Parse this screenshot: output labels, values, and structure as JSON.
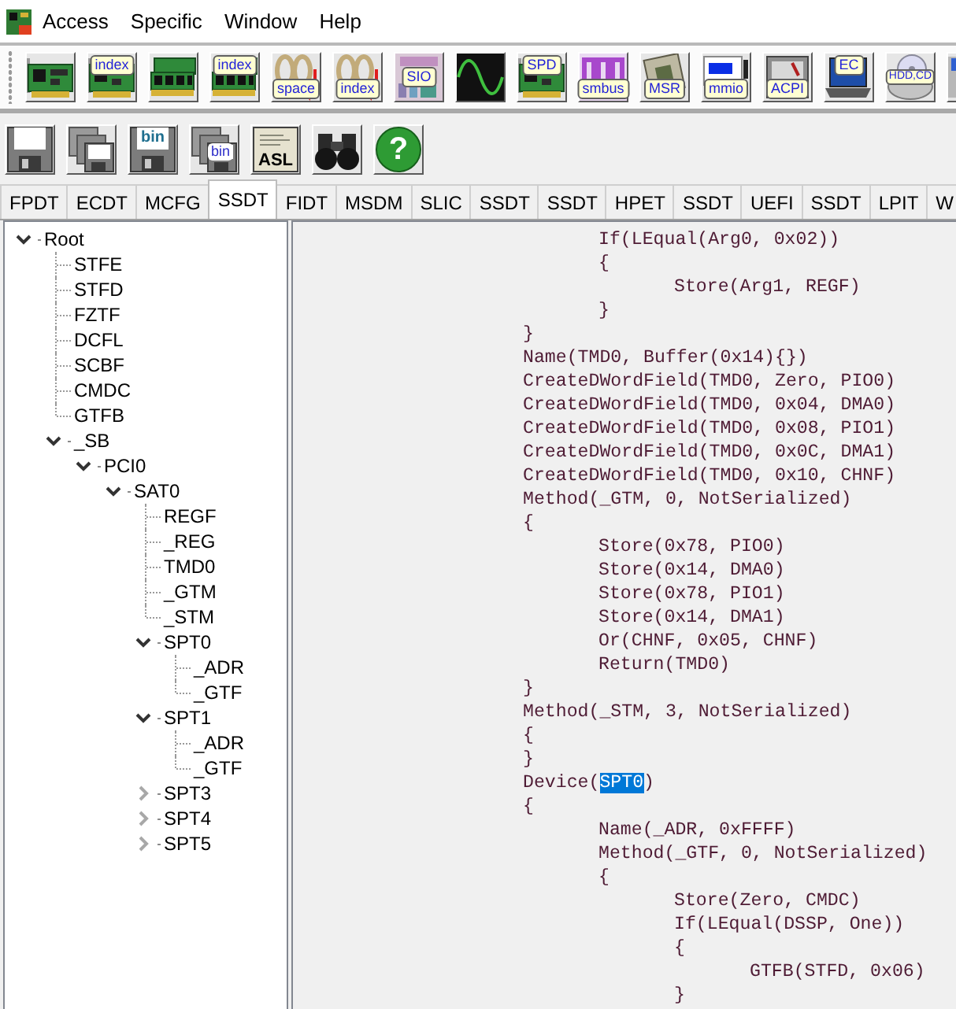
{
  "menu": [
    "Access",
    "Specific",
    "Window",
    "Help"
  ],
  "toolbar_1": [
    {
      "kind": "board"
    },
    {
      "kind": "board",
      "label": "index"
    },
    {
      "kind": "memory"
    },
    {
      "kind": "memory",
      "label": "index"
    },
    {
      "kind": "cable",
      "label": "space"
    },
    {
      "kind": "cable",
      "label": "index"
    },
    {
      "kind": "chip",
      "label": "SIO"
    },
    {
      "kind": "wave"
    },
    {
      "kind": "board",
      "label": "SPD"
    },
    {
      "kind": "bars",
      "label": "smbus"
    },
    {
      "kind": "processor",
      "label": "MSR"
    },
    {
      "kind": "window",
      "label": "mmio"
    },
    {
      "kind": "folder",
      "label": "ACPI"
    },
    {
      "kind": "laptop",
      "label": "EC"
    },
    {
      "kind": "disc",
      "label": "HDD,CD"
    },
    {
      "kind": "device"
    }
  ],
  "toolbar_2": [
    {
      "kind": "floppy"
    },
    {
      "kind": "floppies"
    },
    {
      "kind": "floppy",
      "label": "bin"
    },
    {
      "kind": "floppies",
      "label": "bin"
    },
    {
      "kind": "document",
      "label": "ASL"
    },
    {
      "kind": "binoculars"
    },
    {
      "kind": "help",
      "label": "?"
    }
  ],
  "tabs": [
    {
      "label": "FPDT",
      "selected": false
    },
    {
      "label": "ECDT",
      "selected": false
    },
    {
      "label": "MCFG",
      "selected": false
    },
    {
      "label": "SSDT",
      "selected": true
    },
    {
      "label": "FIDT",
      "selected": false
    },
    {
      "label": "MSDM",
      "selected": false
    },
    {
      "label": "SLIC",
      "selected": false
    },
    {
      "label": "SSDT",
      "selected": false
    },
    {
      "label": "SSDT",
      "selected": false
    },
    {
      "label": "HPET",
      "selected": false
    },
    {
      "label": "SSDT",
      "selected": false
    },
    {
      "label": "UEFI",
      "selected": false
    },
    {
      "label": "SSDT",
      "selected": false
    },
    {
      "label": "LPIT",
      "selected": false
    },
    {
      "label": "W",
      "selected": false
    }
  ],
  "tree": [
    {
      "label": "Root",
      "kind": "node",
      "expanded": true,
      "children": [
        {
          "label": "STFE",
          "kind": "leaf"
        },
        {
          "label": "STFD",
          "kind": "leaf"
        },
        {
          "label": "FZTF",
          "kind": "leaf"
        },
        {
          "label": "DCFL",
          "kind": "leaf"
        },
        {
          "label": "SCBF",
          "kind": "leaf"
        },
        {
          "label": "CMDC",
          "kind": "leaf"
        },
        {
          "label": "GTFB",
          "kind": "leaf"
        },
        {
          "label": "_SB",
          "kind": "node",
          "expanded": true,
          "children": [
            {
              "label": "PCI0",
              "kind": "node",
              "expanded": true,
              "children": [
                {
                  "label": "SAT0",
                  "kind": "node",
                  "expanded": true,
                  "children": [
                    {
                      "label": "REGF",
                      "kind": "leaf"
                    },
                    {
                      "label": "_REG",
                      "kind": "leaf"
                    },
                    {
                      "label": "TMD0",
                      "kind": "leaf"
                    },
                    {
                      "label": "_GTM",
                      "kind": "leaf"
                    },
                    {
                      "label": "_STM",
                      "kind": "leaf"
                    },
                    {
                      "label": "SPT0",
                      "kind": "node",
                      "expanded": true,
                      "children": [
                        {
                          "label": "_ADR",
                          "kind": "leaf"
                        },
                        {
                          "label": "_GTF",
                          "kind": "leaf"
                        }
                      ]
                    },
                    {
                      "label": "SPT1",
                      "kind": "node",
                      "expanded": true,
                      "children": [
                        {
                          "label": "_ADR",
                          "kind": "leaf"
                        },
                        {
                          "label": "_GTF",
                          "kind": "leaf"
                        }
                      ]
                    },
                    {
                      "label": "SPT3",
                      "kind": "node",
                      "expanded": false
                    },
                    {
                      "label": "SPT4",
                      "kind": "node",
                      "expanded": false
                    },
                    {
                      "label": "SPT5",
                      "kind": "node",
                      "expanded": false
                    }
                  ]
                }
              ]
            }
          ]
        }
      ]
    }
  ],
  "code_lines": [
    {
      "text": "\t\t\t\tIf(LEqual(Arg0, 0x02))"
    },
    {
      "text": "\t\t\t\t{"
    },
    {
      "text": "\t\t\t\t\tStore(Arg1, REGF)"
    },
    {
      "text": "\t\t\t\t}"
    },
    {
      "text": "\t\t\t}"
    },
    {
      "text": "\t\t\tName(TMD0, Buffer(0x14){})"
    },
    {
      "text": "\t\t\tCreateDWordField(TMD0, Zero, PIO0)"
    },
    {
      "text": "\t\t\tCreateDWordField(TMD0, 0x04, DMA0)"
    },
    {
      "text": "\t\t\tCreateDWordField(TMD0, 0x08, PIO1)"
    },
    {
      "text": "\t\t\tCreateDWordField(TMD0, 0x0C, DMA1)"
    },
    {
      "text": "\t\t\tCreateDWordField(TMD0, 0x10, CHNF)"
    },
    {
      "text": "\t\t\tMethod(_GTM, 0, NotSerialized)"
    },
    {
      "text": "\t\t\t{"
    },
    {
      "text": "\t\t\t\tStore(0x78, PIO0)"
    },
    {
      "text": "\t\t\t\tStore(0x14, DMA0)"
    },
    {
      "text": "\t\t\t\tStore(0x78, PIO1)"
    },
    {
      "text": "\t\t\t\tStore(0x14, DMA1)"
    },
    {
      "text": "\t\t\t\tOr(CHNF, 0x05, CHNF)"
    },
    {
      "text": "\t\t\t\tReturn(TMD0)"
    },
    {
      "text": "\t\t\t}"
    },
    {
      "text": "\t\t\tMethod(_STM, 3, NotSerialized)"
    },
    {
      "text": "\t\t\t{"
    },
    {
      "text": "\t\t\t}"
    },
    {
      "text": "\t\t\tDevice(",
      "selection": "SPT0",
      "text_after": ")"
    },
    {
      "text": "\t\t\t{"
    },
    {
      "text": "\t\t\t\tName(_ADR, 0xFFFF)"
    },
    {
      "text": "\t\t\t\tMethod(_GTF, 0, NotSerialized)"
    },
    {
      "text": "\t\t\t\t{"
    },
    {
      "text": "\t\t\t\t\tStore(Zero, CMDC)"
    },
    {
      "text": "\t\t\t\t\tIf(LEqual(DSSP, One))"
    },
    {
      "text": "\t\t\t\t\t{"
    },
    {
      "text": "\t\t\t\t\t\tGTFB(STFD, 0x06)"
    },
    {
      "text": "\t\t\t\t\t}"
    }
  ]
}
